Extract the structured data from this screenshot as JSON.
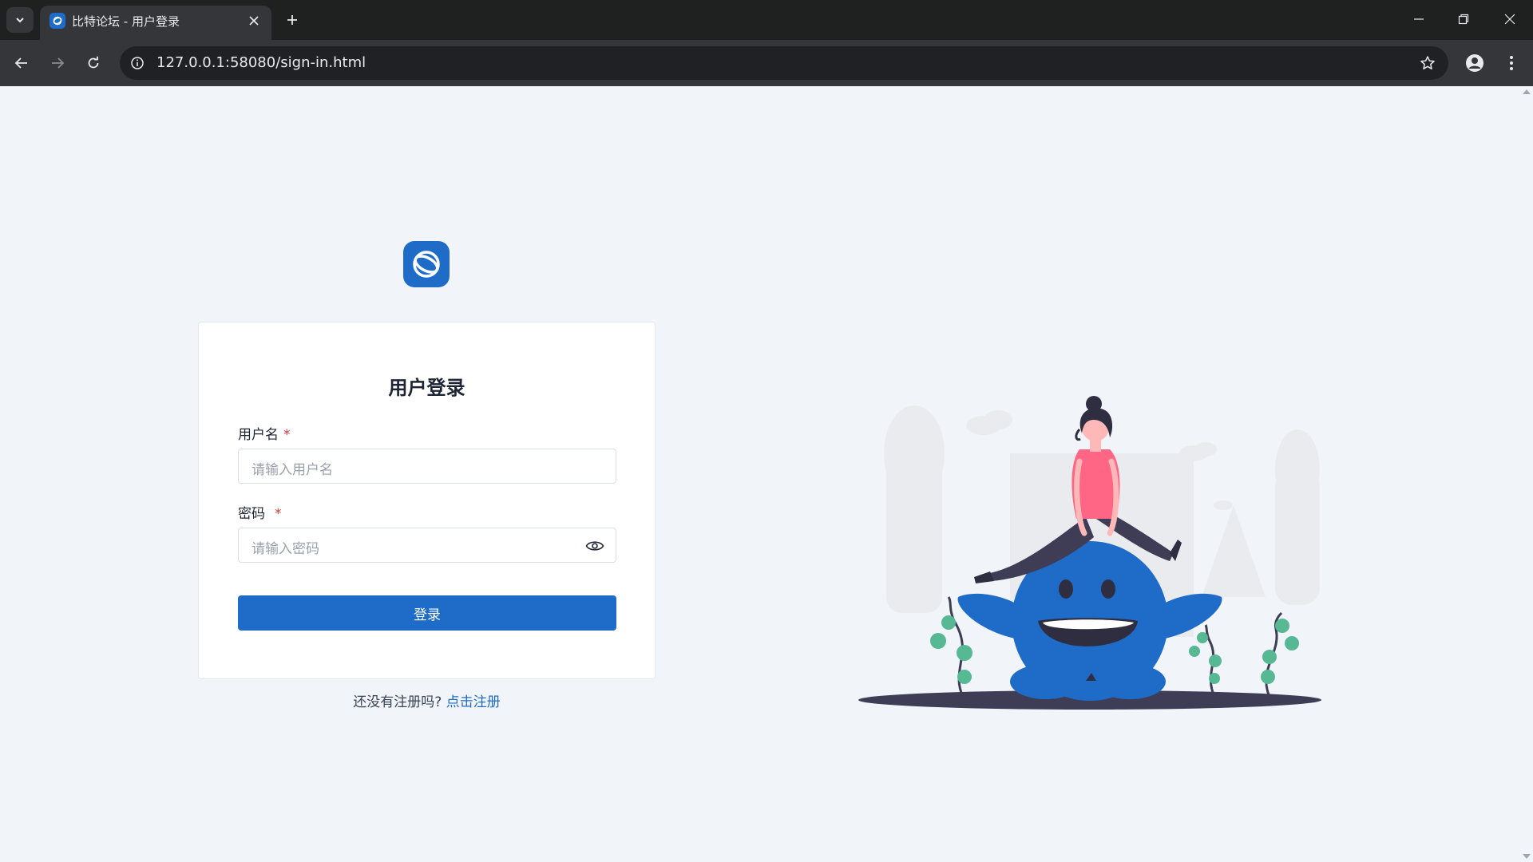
{
  "browser": {
    "tab_title": "比特论坛 - 用户登录",
    "url": "127.0.0.1:58080/sign-in.html"
  },
  "login": {
    "title": "用户登录",
    "username_label": "用户名",
    "username_placeholder": "请输入用户名",
    "password_label": "密码",
    "password_placeholder": "请输入密码",
    "required_mark": "*",
    "submit_label": "登录",
    "signup_prompt": "还没有注册吗? ",
    "signup_link": "点击注册"
  },
  "colors": {
    "brand": "#1e6cc8",
    "page_bg": "#f1f4f9",
    "required": "#d63939"
  }
}
